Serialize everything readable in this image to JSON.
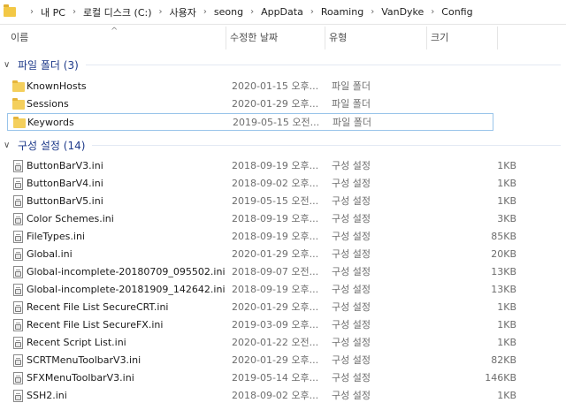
{
  "breadcrumb": [
    "내 PC",
    "로컬 디스크 (C:)",
    "사용자",
    "seong",
    "AppData",
    "Roaming",
    "VanDyke",
    "Config"
  ],
  "columns": {
    "name": "이름",
    "date": "수정한 날짜",
    "type": "유형",
    "size": "크기"
  },
  "groups": [
    {
      "title": "파일 폴더 (3)",
      "items": [
        {
          "name": "KnownHosts",
          "date": "2020-01-15 오후...",
          "type": "파일 폴더",
          "size": ""
        },
        {
          "name": "Sessions",
          "date": "2020-01-29 오후...",
          "type": "파일 폴더",
          "size": ""
        },
        {
          "name": "Keywords",
          "date": "2019-05-15 오전...",
          "type": "파일 폴더",
          "size": ""
        }
      ]
    },
    {
      "title": "구성 설정 (14)",
      "items": [
        {
          "name": "ButtonBarV3.ini",
          "date": "2018-09-19 오후...",
          "type": "구성 설정",
          "size": "1KB"
        },
        {
          "name": "ButtonBarV4.ini",
          "date": "2018-09-02 오후...",
          "type": "구성 설정",
          "size": "1KB"
        },
        {
          "name": "ButtonBarV5.ini",
          "date": "2019-05-15 오전...",
          "type": "구성 설정",
          "size": "1KB"
        },
        {
          "name": "Color Schemes.ini",
          "date": "2018-09-19 오후...",
          "type": "구성 설정",
          "size": "3KB"
        },
        {
          "name": "FileTypes.ini",
          "date": "2018-09-19 오후...",
          "type": "구성 설정",
          "size": "85KB"
        },
        {
          "name": "Global.ini",
          "date": "2020-01-29 오후...",
          "type": "구성 설정",
          "size": "20KB"
        },
        {
          "name": "Global-incomplete-20180709_095502.ini",
          "date": "2018-09-07 오전...",
          "type": "구성 설정",
          "size": "13KB"
        },
        {
          "name": "Global-incomplete-20181909_142642.ini",
          "date": "2018-09-19 오후...",
          "type": "구성 설정",
          "size": "13KB"
        },
        {
          "name": "Recent File List SecureCRT.ini",
          "date": "2020-01-29 오후...",
          "type": "구성 설정",
          "size": "1KB"
        },
        {
          "name": "Recent File List SecureFX.ini",
          "date": "2019-03-09 오후...",
          "type": "구성 설정",
          "size": "1KB"
        },
        {
          "name": "Recent Script List.ini",
          "date": "2020-01-22 오전...",
          "type": "구성 설정",
          "size": "1KB"
        },
        {
          "name": "SCRTMenuToolbarV3.ini",
          "date": "2020-01-29 오후...",
          "type": "구성 설정",
          "size": "82KB"
        },
        {
          "name": "SFXMenuToolbarV3.ini",
          "date": "2019-05-14 오후...",
          "type": "구성 설정",
          "size": "146KB"
        },
        {
          "name": "SSH2.ini",
          "date": "2018-09-02 오후...",
          "type": "구성 설정",
          "size": "1KB"
        }
      ]
    }
  ],
  "selected": "Keywords",
  "colors": {
    "group_title": "#1e3a8a",
    "selection_border": "#99c4ea",
    "folder": "#f4cf5c"
  }
}
